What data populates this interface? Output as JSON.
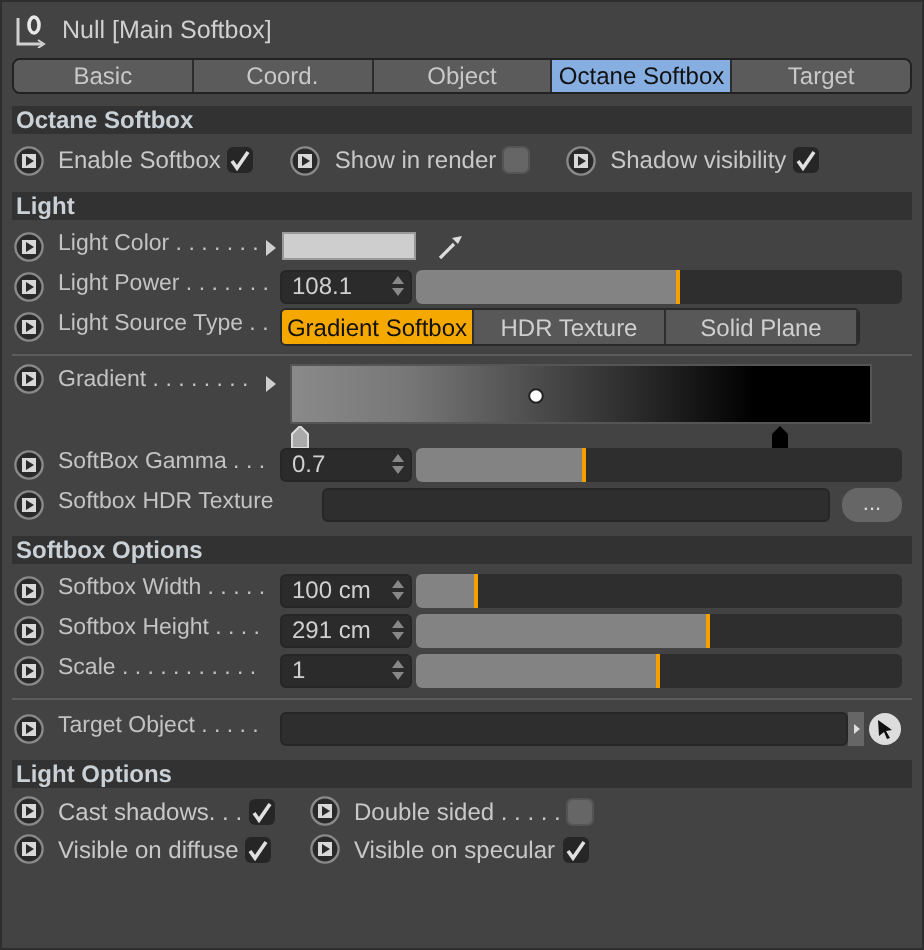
{
  "window": {
    "title": "Null [Main Softbox]"
  },
  "tabs": [
    {
      "label": "Basic",
      "selected": false
    },
    {
      "label": "Coord.",
      "selected": false
    },
    {
      "label": "Object",
      "selected": false
    },
    {
      "label": "Octane Softbox",
      "selected": true
    },
    {
      "label": "Target",
      "selected": false
    }
  ],
  "sections": [
    {
      "title": "Octane Softbox",
      "rows": [
        {
          "kind": "checks",
          "items": [
            {
              "label": "Enable Softbox",
              "checked": true
            },
            {
              "label": "Show in render",
              "checked": false
            },
            {
              "label": "Shadow visibility",
              "checked": true
            }
          ]
        }
      ]
    },
    {
      "title": "Light",
      "rows": [
        {
          "kind": "color",
          "label": "Light Color . . . . . . ."
        },
        {
          "kind": "slider",
          "label": "Light Power . . . . . . .",
          "value": "108.1",
          "level": 0.545
        },
        {
          "kind": "choice",
          "label": "Light Source Type  . .",
          "options": [
            {
              "label": "Gradient Softbox",
              "selected": true
            },
            {
              "label": "HDR Texture",
              "selected": false
            },
            {
              "label": "Solid Plane",
              "selected": false
            }
          ]
        },
        {
          "kind": "divider"
        },
        {
          "kind": "gradient",
          "label": "Gradient . . . . . . . ."
        },
        {
          "kind": "slider",
          "label": "SoftBox Gamma . . . ",
          "value": "0.7",
          "level": 0.35
        },
        {
          "kind": "file",
          "label": "Softbox HDR Texture",
          "button": "..."
        }
      ]
    },
    {
      "title": "Softbox Options",
      "rows": [
        {
          "kind": "slider",
          "label": "Softbox Width . . . . .",
          "value": "100 cm",
          "level": 0.126
        },
        {
          "kind": "slider",
          "label": "Softbox Height  . . . .",
          "value": "291 cm",
          "level": 0.605
        },
        {
          "kind": "slider",
          "label": "Scale . . . . . . . . . . .",
          "value": "1",
          "level": 0.504
        },
        {
          "kind": "divider"
        },
        {
          "kind": "link",
          "label": "Target Object . . . . ."
        }
      ]
    },
    {
      "title": "Light Options",
      "rows": [
        {
          "kind": "grid",
          "items": [
            {
              "label": "Cast shadows. . .",
              "checked": true
            },
            {
              "label": "Double sided . . . . .",
              "checked": false
            },
            {
              "label": "Visible on diffuse",
              "checked": true
            },
            {
              "label": "Visible on specular",
              "checked": true
            }
          ]
        }
      ]
    }
  ]
}
